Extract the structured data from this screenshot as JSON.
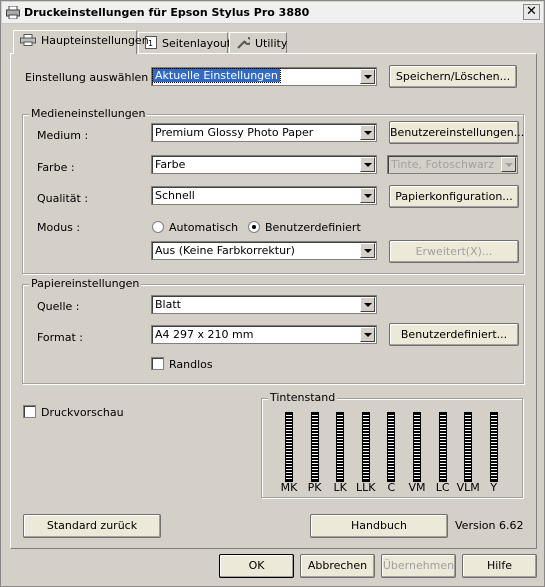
{
  "window": {
    "title": "Druckeinstellungen für Epson Stylus Pro 3880"
  },
  "tabs": [
    {
      "label": "Haupteinstellungen"
    },
    {
      "label": "Seitenlayout"
    },
    {
      "label": "Utility"
    }
  ],
  "setting_select": {
    "label": "Einstellung auswählen :",
    "value": "Aktuelle Einstellungen",
    "save_button": "Speichern/Löschen..."
  },
  "media": {
    "group_title": "Medieneinstellungen",
    "medium_label": "Medium :",
    "medium_value": "Premium Glossy Photo Paper",
    "custom_button": "Benutzereinstellungen...",
    "color_label": "Farbe :",
    "color_value": "Farbe",
    "ink_value": "Tinte, Fotoschwarz",
    "quality_label": "Qualität :",
    "quality_value": "Schnell",
    "paper_config_button": "Papierkonfiguration...",
    "mode_label": "Modus :",
    "mode_auto": "Automatisch",
    "mode_custom": "Benutzerdefiniert",
    "mode_selected": "Benutzerdefiniert",
    "color_correction_value": "Aus (Keine Farbkorrektur)",
    "advanced_button": "Erweitert(X)..."
  },
  "paper": {
    "group_title": "Papiereinstellungen",
    "source_label": "Quelle :",
    "source_value": "Blatt",
    "format_label": "Format :",
    "format_value": "A4 297 x 210 mm",
    "custom_button": "Benutzerdefiniert...",
    "borderless_label": "Randlos",
    "borderless_checked": false
  },
  "preview": {
    "label": "Druckvorschau",
    "checked": false
  },
  "ink_levels": {
    "title": "Tintenstand",
    "cartridges": [
      "MK",
      "PK",
      "LK",
      "LLK",
      "C",
      "VM",
      "LC",
      "VLM",
      "Y"
    ]
  },
  "footer": {
    "defaults_button": "Standard zurück",
    "manual_button": "Handbuch",
    "version": "Version 6.62"
  },
  "dialog_buttons": {
    "ok": "OK",
    "cancel": "Abbrechen",
    "apply": "Übernehmen",
    "help": "Hilfe"
  }
}
